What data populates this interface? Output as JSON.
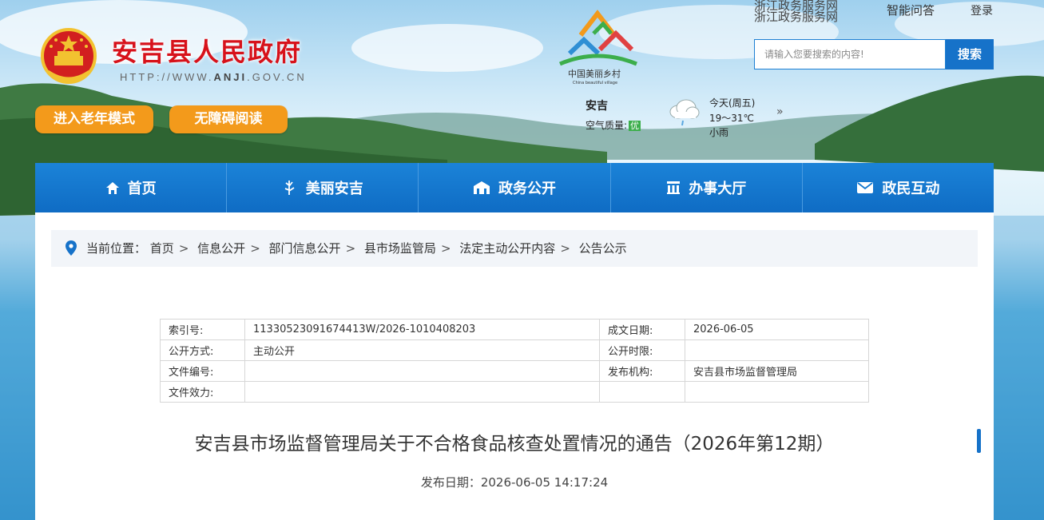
{
  "header": {
    "site_title": "安吉县人民政府",
    "site_url_prefix": "HTTP://WWW.",
    "site_url_bold": "ANJI",
    "site_url_suffix": ".GOV.CN",
    "elder_mode_label": "进入老年模式",
    "accessible_label": "无障碍阅读"
  },
  "top_links": {
    "zhejiang_service": "浙江政务服务网",
    "smart_qa": "智能问答",
    "login": "登录"
  },
  "search": {
    "placeholder": "请输入您要搜索的内容!",
    "button": "搜索"
  },
  "village_logo": {
    "text_cn": "中国美丽乡村",
    "text_en": "China beautiful village"
  },
  "weather": {
    "city": "安吉",
    "air_quality_label": "空气质量:",
    "air_quality_value": "优",
    "day": "今天(周五)",
    "temperature": "19～31℃",
    "description": "小雨",
    "more": "»"
  },
  "nav": {
    "items": [
      {
        "label": "首页",
        "icon": "home-icon"
      },
      {
        "label": "美丽安吉",
        "icon": "bamboo-icon"
      },
      {
        "label": "政务公开",
        "icon": "building-icon"
      },
      {
        "label": "办事大厅",
        "icon": "hall-icon"
      },
      {
        "label": "政民互动",
        "icon": "mail-icon"
      }
    ]
  },
  "breadcrumb": {
    "prefix": "当前位置：",
    "items": [
      "首页",
      "信息公开",
      "部门信息公开",
      "县市场监管局",
      "法定主动公开内容",
      "公告公示"
    ]
  },
  "meta_table": {
    "rows": [
      {
        "k1": "索引号:",
        "v1": "11330523091674413W/2026-1010408203",
        "k2": "成文日期:",
        "v2": "2026-06-05"
      },
      {
        "k1": "公开方式:",
        "v1": "主动公开",
        "k2": "公开时限:",
        "v2": ""
      },
      {
        "k1": "文件编号:",
        "v1": "",
        "k2": "发布机构:",
        "v2": "安吉县市场监督管理局"
      },
      {
        "k1": "文件效力:",
        "v1": "",
        "k2": "",
        "v2": ""
      }
    ]
  },
  "article": {
    "title": "安吉县市场监督管理局关于不合格食品核查处置情况的通告（2026年第12期）",
    "publish_date": "发布日期：2026-06-05 14:17:24"
  },
  "colors": {
    "nav_blue": "#1672c9",
    "title_red": "#d7121b",
    "mode_orange": "#f39a1b",
    "aq_green": "#3cae4b"
  }
}
